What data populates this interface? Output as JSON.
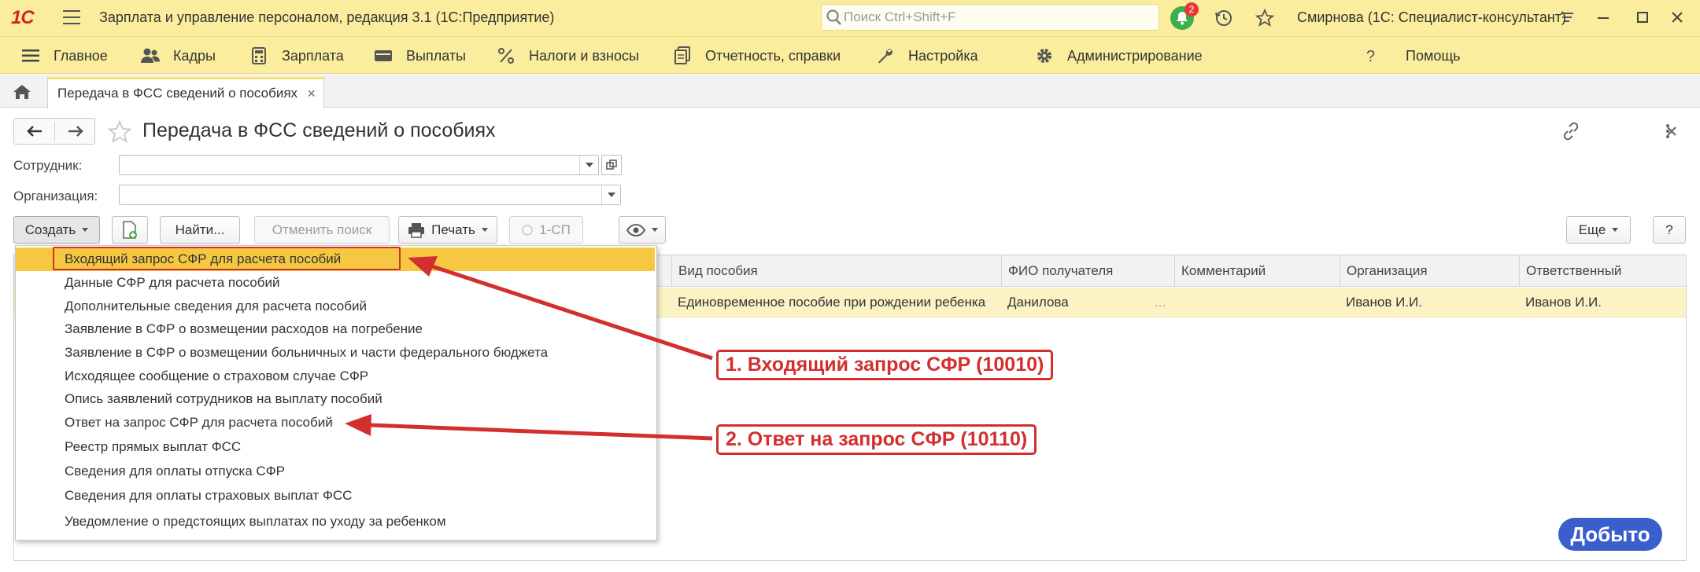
{
  "titlebar": {
    "logo": "1С",
    "app_title": "Зарплата и управление персоналом, редакция 3.1  (1С:Предприятие)",
    "search_placeholder": "Поиск Ctrl+Shift+F",
    "notifications_count": "2",
    "user": "Смирнова (1С: Специалист-консультант)"
  },
  "menu": {
    "items": [
      {
        "label": "Главное",
        "icon": "hamburger-icon"
      },
      {
        "label": "Кадры",
        "icon": "people-icon"
      },
      {
        "label": "Зарплата",
        "icon": "calculator-icon"
      },
      {
        "label": "Выплаты",
        "icon": "wallet-icon"
      },
      {
        "label": "Налоги и взносы",
        "icon": "percent-icon"
      },
      {
        "label": "Отчетность, справки",
        "icon": "documents-icon"
      },
      {
        "label": "Настройка",
        "icon": "wrench-icon"
      },
      {
        "label": "Администрирование",
        "icon": "gear-icon"
      },
      {
        "label": "Помощь",
        "icon": "question-icon"
      }
    ]
  },
  "tabs": {
    "open_tab": "Передача в ФСС сведений о пособиях",
    "close_glyph": "×"
  },
  "form": {
    "title": "Передача в ФСС сведений о пособиях",
    "employee_label": "Сотрудник:",
    "employee_value": "",
    "organization_label": "Организация:",
    "organization_value": ""
  },
  "commandbar": {
    "create": "Создать",
    "find": "Найти...",
    "cancel_search": "Отменить поиск",
    "print": "Печать",
    "sp1": "1-СП",
    "more": "Еще",
    "help": "?"
  },
  "table": {
    "columns": [
      "Вид пособия",
      "ФИО получателя",
      "Комментарий",
      "Организация",
      "Ответственный"
    ],
    "rows": [
      {
        "benefit_type": "Единовременное пособие при рождении ребенка",
        "recipient": "Данилова",
        "comment": "",
        "organization": "Иванов И.И.",
        "responsible": "Иванов И.И."
      }
    ],
    "ellipsis": "..."
  },
  "dropdown": {
    "items": [
      "Входящий запрос СФР для расчета пособий",
      "Данные СФР для расчета пособий",
      "Дополнительные сведения для расчета пособий",
      "Заявление в СФР о возмещении расходов на погребение",
      "Заявление в СФР о возмещении больничных и части федерального бюджета",
      "Исходящее сообщение о страховом случае СФР",
      "Опись заявлений сотрудников на выплату пособий",
      "Ответ на запрос СФР для расчета пособий",
      "Реестр прямых выплат ФСС",
      "Сведения для оплаты отпуска СФР",
      "Сведения для оплаты страховых выплат ФСС",
      "Уведомление о предстоящих выплатах по уходу за ребенком"
    ]
  },
  "annotations": {
    "callout1": "1. Входящий запрос СФР (10010)",
    "callout2": "2. Ответ на запрос СФР (10110)"
  },
  "overlay": {
    "next_button": "Добыто"
  },
  "colors": {
    "header_bg": "#fbed9e",
    "dropdown_active": "#f6c842",
    "selected_row": "#fcf3c5",
    "annotation_red": "#d32f2f",
    "next_button_bg": "#3a5fcd",
    "logo_red": "#d0261f"
  }
}
